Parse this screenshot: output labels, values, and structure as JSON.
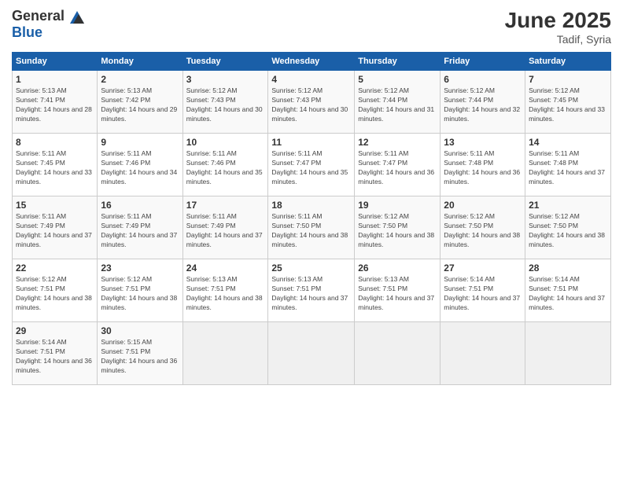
{
  "header": {
    "logo_general": "General",
    "logo_blue": "Blue",
    "month_year": "June 2025",
    "location": "Tadif, Syria"
  },
  "days_of_week": [
    "Sunday",
    "Monday",
    "Tuesday",
    "Wednesday",
    "Thursday",
    "Friday",
    "Saturday"
  ],
  "weeks": [
    [
      {
        "day": "1",
        "sunrise": "5:13 AM",
        "sunset": "7:41 PM",
        "daylight": "14 hours and 28 minutes."
      },
      {
        "day": "2",
        "sunrise": "5:13 AM",
        "sunset": "7:42 PM",
        "daylight": "14 hours and 29 minutes."
      },
      {
        "day": "3",
        "sunrise": "5:12 AM",
        "sunset": "7:43 PM",
        "daylight": "14 hours and 30 minutes."
      },
      {
        "day": "4",
        "sunrise": "5:12 AM",
        "sunset": "7:43 PM",
        "daylight": "14 hours and 30 minutes."
      },
      {
        "day": "5",
        "sunrise": "5:12 AM",
        "sunset": "7:44 PM",
        "daylight": "14 hours and 31 minutes."
      },
      {
        "day": "6",
        "sunrise": "5:12 AM",
        "sunset": "7:44 PM",
        "daylight": "14 hours and 32 minutes."
      },
      {
        "day": "7",
        "sunrise": "5:12 AM",
        "sunset": "7:45 PM",
        "daylight": "14 hours and 33 minutes."
      }
    ],
    [
      {
        "day": "8",
        "sunrise": "5:11 AM",
        "sunset": "7:45 PM",
        "daylight": "14 hours and 33 minutes."
      },
      {
        "day": "9",
        "sunrise": "5:11 AM",
        "sunset": "7:46 PM",
        "daylight": "14 hours and 34 minutes."
      },
      {
        "day": "10",
        "sunrise": "5:11 AM",
        "sunset": "7:46 PM",
        "daylight": "14 hours and 35 minutes."
      },
      {
        "day": "11",
        "sunrise": "5:11 AM",
        "sunset": "7:47 PM",
        "daylight": "14 hours and 35 minutes."
      },
      {
        "day": "12",
        "sunrise": "5:11 AM",
        "sunset": "7:47 PM",
        "daylight": "14 hours and 36 minutes."
      },
      {
        "day": "13",
        "sunrise": "5:11 AM",
        "sunset": "7:48 PM",
        "daylight": "14 hours and 36 minutes."
      },
      {
        "day": "14",
        "sunrise": "5:11 AM",
        "sunset": "7:48 PM",
        "daylight": "14 hours and 37 minutes."
      }
    ],
    [
      {
        "day": "15",
        "sunrise": "5:11 AM",
        "sunset": "7:49 PM",
        "daylight": "14 hours and 37 minutes."
      },
      {
        "day": "16",
        "sunrise": "5:11 AM",
        "sunset": "7:49 PM",
        "daylight": "14 hours and 37 minutes."
      },
      {
        "day": "17",
        "sunrise": "5:11 AM",
        "sunset": "7:49 PM",
        "daylight": "14 hours and 37 minutes."
      },
      {
        "day": "18",
        "sunrise": "5:11 AM",
        "sunset": "7:50 PM",
        "daylight": "14 hours and 38 minutes."
      },
      {
        "day": "19",
        "sunrise": "5:12 AM",
        "sunset": "7:50 PM",
        "daylight": "14 hours and 38 minutes."
      },
      {
        "day": "20",
        "sunrise": "5:12 AM",
        "sunset": "7:50 PM",
        "daylight": "14 hours and 38 minutes."
      },
      {
        "day": "21",
        "sunrise": "5:12 AM",
        "sunset": "7:50 PM",
        "daylight": "14 hours and 38 minutes."
      }
    ],
    [
      {
        "day": "22",
        "sunrise": "5:12 AM",
        "sunset": "7:51 PM",
        "daylight": "14 hours and 38 minutes."
      },
      {
        "day": "23",
        "sunrise": "5:12 AM",
        "sunset": "7:51 PM",
        "daylight": "14 hours and 38 minutes."
      },
      {
        "day": "24",
        "sunrise": "5:13 AM",
        "sunset": "7:51 PM",
        "daylight": "14 hours and 38 minutes."
      },
      {
        "day": "25",
        "sunrise": "5:13 AM",
        "sunset": "7:51 PM",
        "daylight": "14 hours and 37 minutes."
      },
      {
        "day": "26",
        "sunrise": "5:13 AM",
        "sunset": "7:51 PM",
        "daylight": "14 hours and 37 minutes."
      },
      {
        "day": "27",
        "sunrise": "5:14 AM",
        "sunset": "7:51 PM",
        "daylight": "14 hours and 37 minutes."
      },
      {
        "day": "28",
        "sunrise": "5:14 AM",
        "sunset": "7:51 PM",
        "daylight": "14 hours and 37 minutes."
      }
    ],
    [
      {
        "day": "29",
        "sunrise": "5:14 AM",
        "sunset": "7:51 PM",
        "daylight": "14 hours and 36 minutes."
      },
      {
        "day": "30",
        "sunrise": "5:15 AM",
        "sunset": "7:51 PM",
        "daylight": "14 hours and 36 minutes."
      },
      null,
      null,
      null,
      null,
      null
    ]
  ]
}
